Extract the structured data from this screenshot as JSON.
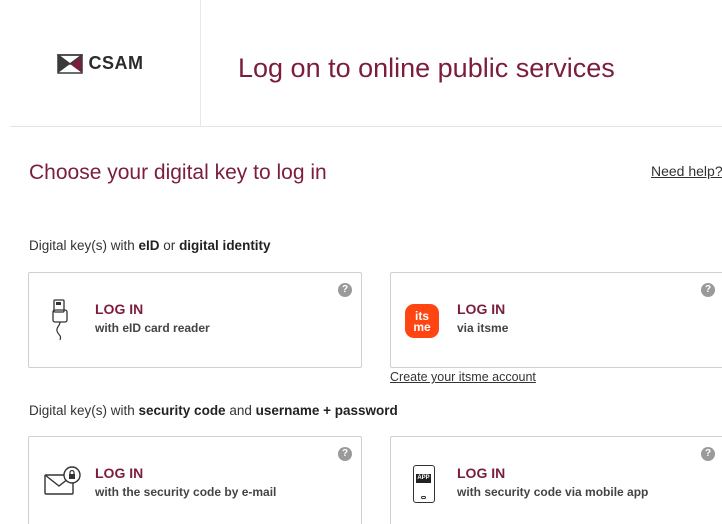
{
  "header": {
    "logo_text": "CSAM",
    "title": "Log on to online public services"
  },
  "main": {
    "heading": "Choose your digital key to log in",
    "need_help": "Need help?"
  },
  "group1": {
    "prefix": "Digital key(s) with ",
    "bold1": "eID",
    "middle": " or ",
    "bold2": "digital identity"
  },
  "group2": {
    "prefix": "Digital key(s) with ",
    "bold1": "security code",
    "middle": " and ",
    "bold2": "username + password"
  },
  "cards": [
    {
      "title": "LOG IN",
      "subtitle": "with eID card reader",
      "help": "?",
      "icon": "card-reader-icon"
    },
    {
      "title": "LOG IN",
      "subtitle": "via itsme",
      "help": "?",
      "icon": "itsme-logo",
      "logo_line1": "its",
      "logo_line2": "me"
    },
    {
      "title": "LOG IN",
      "subtitle": "with the security code by e-mail",
      "help": "?",
      "icon": "email-lock-icon"
    },
    {
      "title": "LOG IN",
      "subtitle": "with security code via mobile app",
      "help": "?",
      "icon": "mobile-app-icon",
      "badge": "APP"
    }
  ],
  "itsme_link": "Create your itsme account",
  "colors": {
    "brand": "#7b1e3b",
    "itsme": "#ff4612",
    "border": "#cfcfcf",
    "help_icon": "#9a9a9a"
  }
}
